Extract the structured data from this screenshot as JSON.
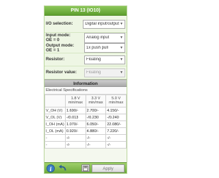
{
  "title": "PIN 13 (IO10)",
  "config": {
    "io_selection": {
      "label": "I/O selection:",
      "value": "Digital input/output"
    },
    "input_mode": {
      "label": "Input mode:",
      "sub": "OE = 0",
      "value": "Analog input"
    },
    "output_mode": {
      "label": "Output mode:",
      "sub": "OE = 1",
      "value": "1x push pull"
    },
    "resistor": {
      "label": "Resistor:",
      "value": "Floating"
    },
    "resistor_value": {
      "label": "Resistor value:",
      "value": "Floating"
    }
  },
  "information": {
    "header": "Information",
    "spec_title": "Electrical Specifications",
    "columns": [
      {
        "line1": "1.8 V",
        "line2": "min/max"
      },
      {
        "line1": "3.3 V",
        "line2": "min/max"
      },
      {
        "line1": "5.0 V",
        "line2": "min/max"
      }
    ],
    "rows": [
      {
        "name": "V_OH (V)",
        "cells": [
          "1.690/-",
          "2.700/-",
          "4.150/-"
        ]
      },
      {
        "name": "V_OL (V)",
        "cells": [
          "-/0.013",
          "-/0.230",
          "-/0.240"
        ]
      },
      {
        "name": "I_OH (mA)",
        "cells": [
          "1.070/-",
          "6.050/-",
          "22.080/-"
        ]
      },
      {
        "name": "I_OL (mA)",
        "cells": [
          "0.920/-",
          "4.880/-",
          "7.220/-"
        ]
      },
      {
        "name": "-",
        "cells": [
          "-/-",
          "-/-",
          "-/-"
        ]
      },
      {
        "name": "-",
        "cells": [
          "-/-",
          "-/-",
          "-/-"
        ]
      }
    ]
  },
  "footer": {
    "info_glyph": "i",
    "apply_label": "Apply"
  },
  "icons": {
    "info": "info-icon",
    "undo": "undo-icon",
    "save": "save-icon",
    "dropdown": "chevron-down-icon"
  },
  "colors": {
    "accent": "#6ca83a",
    "info_button": "#3b7fc4"
  }
}
